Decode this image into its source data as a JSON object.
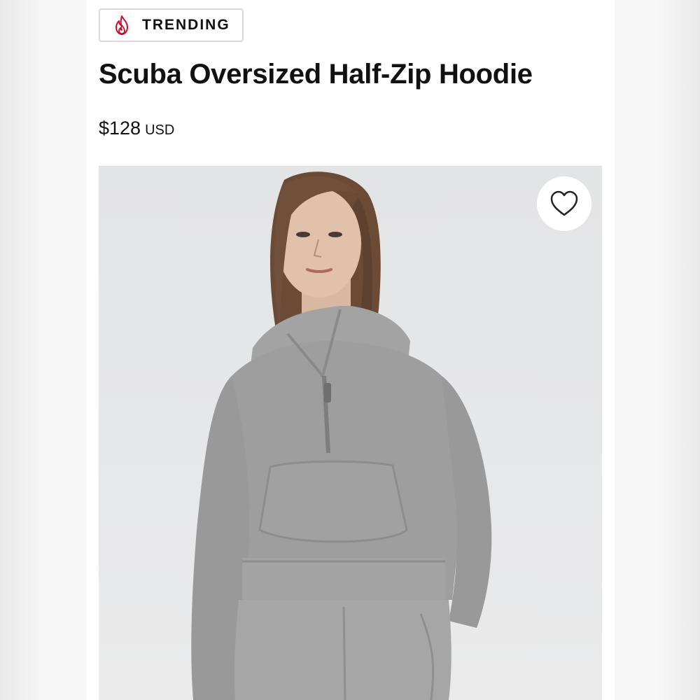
{
  "badge": {
    "label": "TRENDING",
    "icon": "flame-icon",
    "icon_color": "#c8102e"
  },
  "product": {
    "title": "Scuba Oversized Half-Zip Hoodie",
    "price": "$128",
    "currency": "USD",
    "image": "product-model-photo",
    "wishlist_icon": "heart-outline-icon"
  },
  "colors": {
    "text": "#111111",
    "photo_background": "#e5e6e8",
    "garment": "#9e9e9e"
  }
}
